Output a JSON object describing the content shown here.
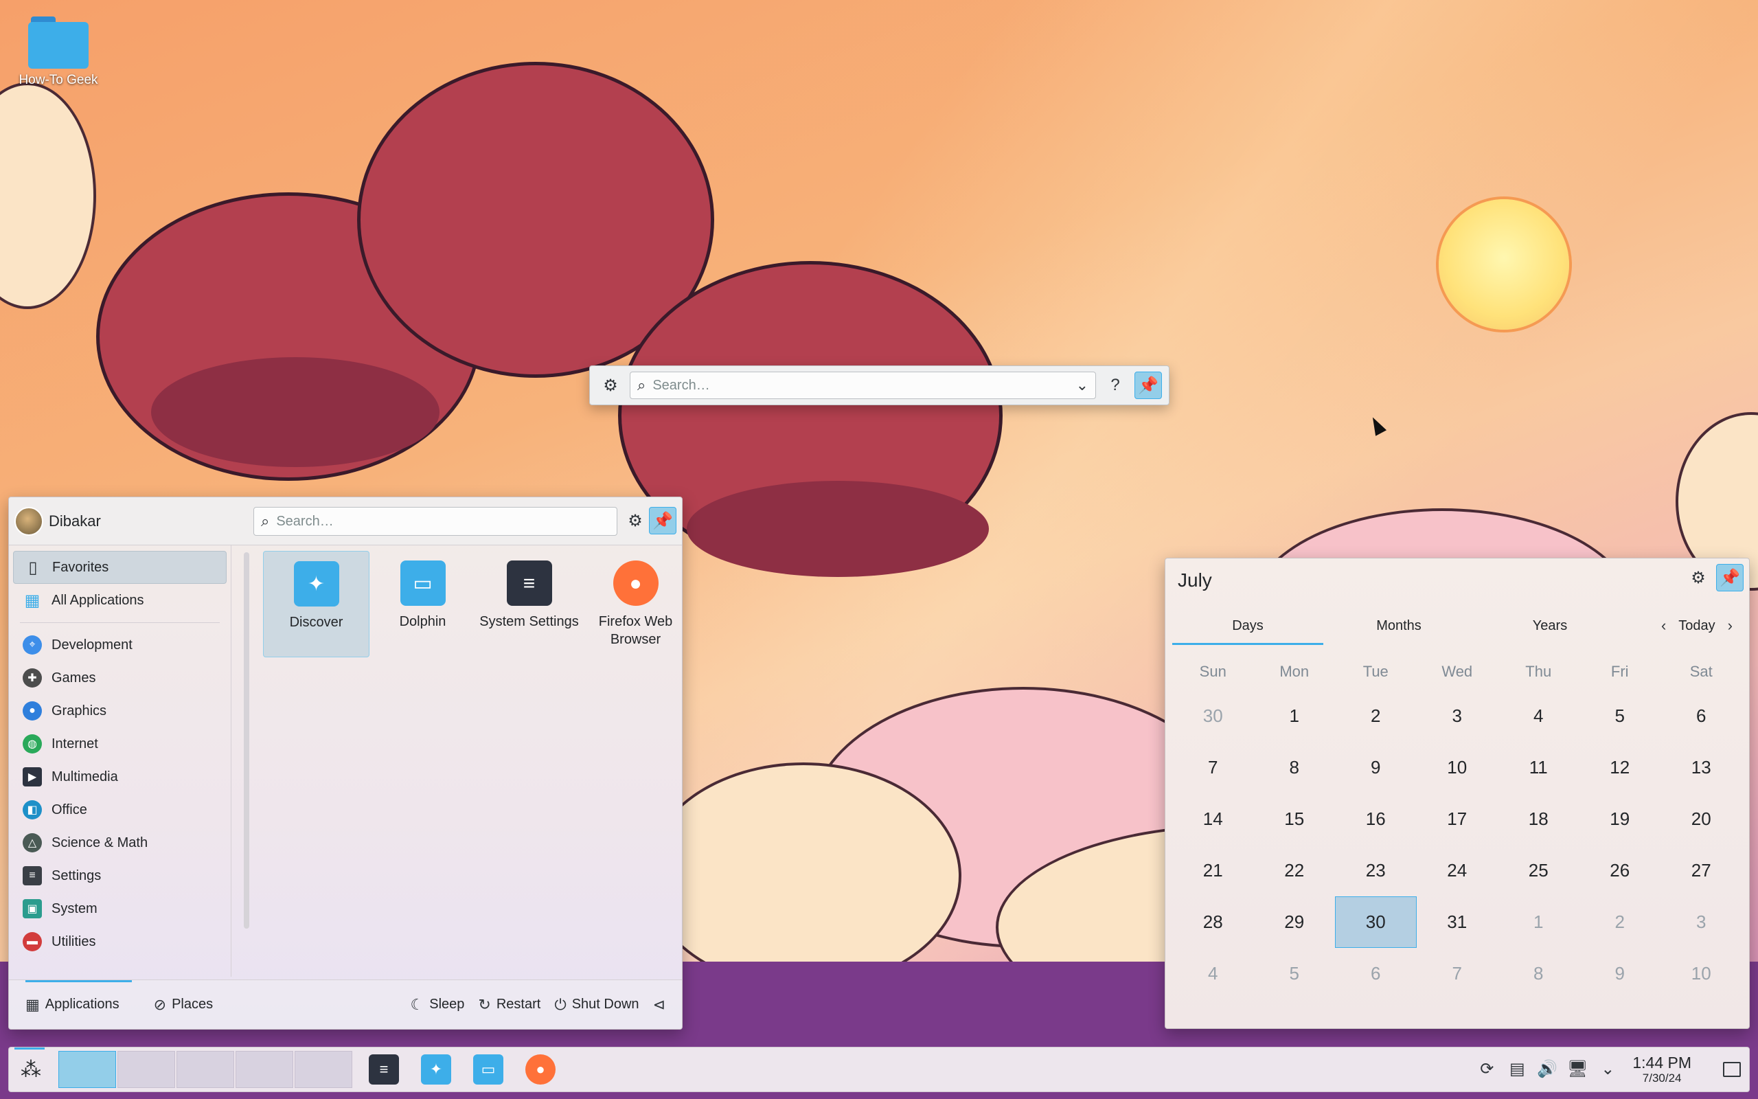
{
  "desktop": {
    "icon_label": "How-To Geek"
  },
  "krunner": {
    "placeholder": "Search…",
    "help": "?"
  },
  "kickoff": {
    "user": "Dibakar",
    "search_placeholder": "Search…",
    "sidebar": [
      {
        "label": "Favorites",
        "icon": "bookmark-icon"
      },
      {
        "label": "All Applications",
        "icon": "grid-icon"
      },
      {
        "label": "Development",
        "icon": "development-icon",
        "color": "#3d8ee9"
      },
      {
        "label": "Games",
        "icon": "gamepad-icon",
        "color": "#4d4d4d"
      },
      {
        "label": "Graphics",
        "icon": "graphics-icon",
        "color": "#2f7fdc"
      },
      {
        "label": "Internet",
        "icon": "globe-icon",
        "color": "#2aa95a"
      },
      {
        "label": "Multimedia",
        "icon": "multimedia-icon",
        "color": "#2d3340"
      },
      {
        "label": "Office",
        "icon": "office-icon",
        "color": "#1e90c8"
      },
      {
        "label": "Science & Math",
        "icon": "science-icon",
        "color": "#4a5a55"
      },
      {
        "label": "Settings",
        "icon": "settings-icon",
        "color": "#3a3f46"
      },
      {
        "label": "System",
        "icon": "system-icon",
        "color": "#2b9c8e"
      },
      {
        "label": "Utilities",
        "icon": "utilities-icon",
        "color": "#d23c3c"
      }
    ],
    "apps": [
      {
        "label": "Discover",
        "icon": "discover-icon",
        "color": "#3daee9"
      },
      {
        "label": "Dolphin",
        "icon": "dolphin-folder-icon",
        "color": "#3daee9"
      },
      {
        "label": "System Settings",
        "icon": "system-settings-icon",
        "color": "#2d3340"
      },
      {
        "label": "Firefox Web Browser",
        "icon": "firefox-icon",
        "color": "#ff7139"
      }
    ],
    "footer": {
      "applications": "Applications",
      "places": "Places",
      "sleep": "Sleep",
      "restart": "Restart",
      "shutdown": "Shut Down"
    }
  },
  "calendar": {
    "month": "July",
    "tabs": [
      "Days",
      "Months",
      "Years"
    ],
    "today_label": "Today",
    "weekdays": [
      "Sun",
      "Mon",
      "Tue",
      "Wed",
      "Thu",
      "Fri",
      "Sat"
    ],
    "days": [
      [
        "30",
        "1",
        "2",
        "3",
        "4",
        "5",
        "6"
      ],
      [
        "7",
        "8",
        "9",
        "10",
        "11",
        "12",
        "13"
      ],
      [
        "14",
        "15",
        "16",
        "17",
        "18",
        "19",
        "20"
      ],
      [
        "21",
        "22",
        "23",
        "24",
        "25",
        "26",
        "27"
      ],
      [
        "28",
        "29",
        "30",
        "31",
        "1",
        "2",
        "3"
      ],
      [
        "4",
        "5",
        "6",
        "7",
        "8",
        "9",
        "10"
      ]
    ],
    "selected_day": "30"
  },
  "taskbar": {
    "time": "1:44 PM",
    "date": "7/30/24"
  },
  "colors": {
    "accent": "#3daee9",
    "selection": "#93cee9"
  }
}
